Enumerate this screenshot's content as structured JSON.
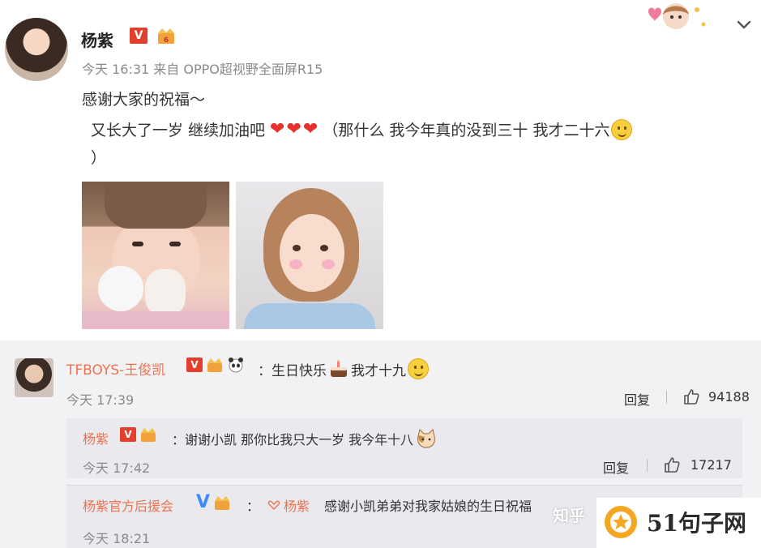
{
  "post": {
    "author": "杨紫",
    "v_badge": "V",
    "meta": "今天 16:31 来自 OPPO超视野全面屏R15",
    "line1": "感谢大家的祝福～",
    "line2_a": "又长大了一岁 继续加油吧",
    "line2_b": "（那什么 我今年真的没到三十 我才二十六",
    "line3": "）",
    "icons": [
      "chevron-down-icon",
      "heart-icon",
      "smile-icon",
      "crown-icon"
    ]
  },
  "comment": {
    "author": "TFBOYS-王俊凯",
    "v_badge": "V",
    "text_a": "：生日快乐",
    "text_b": "我才十九",
    "time": "今天 17:39",
    "reply": "回复",
    "likes": "94188"
  },
  "reply1": {
    "author": "杨紫",
    "v_badge": "V",
    "text": "：谢谢小凯 那你比我只大一岁 我今年十八",
    "time": "今天 17:42",
    "reply": "回复",
    "likes": "17217"
  },
  "reply2": {
    "author": "杨紫官方后援会",
    "v_badge": "V",
    "colon": "：",
    "mention": "杨紫",
    "text": "感谢小凯弟弟对我家姑娘的生日祝福",
    "time": "今天 18:21"
  },
  "watermark": {
    "zhihu": "知乎",
    "site": "51句子网"
  },
  "colors": {
    "name_orange": "#eb7350",
    "badge_red": "#e0402d",
    "big_v_blue": "#3a8bff",
    "comment_bg": "#f2f2f5"
  }
}
